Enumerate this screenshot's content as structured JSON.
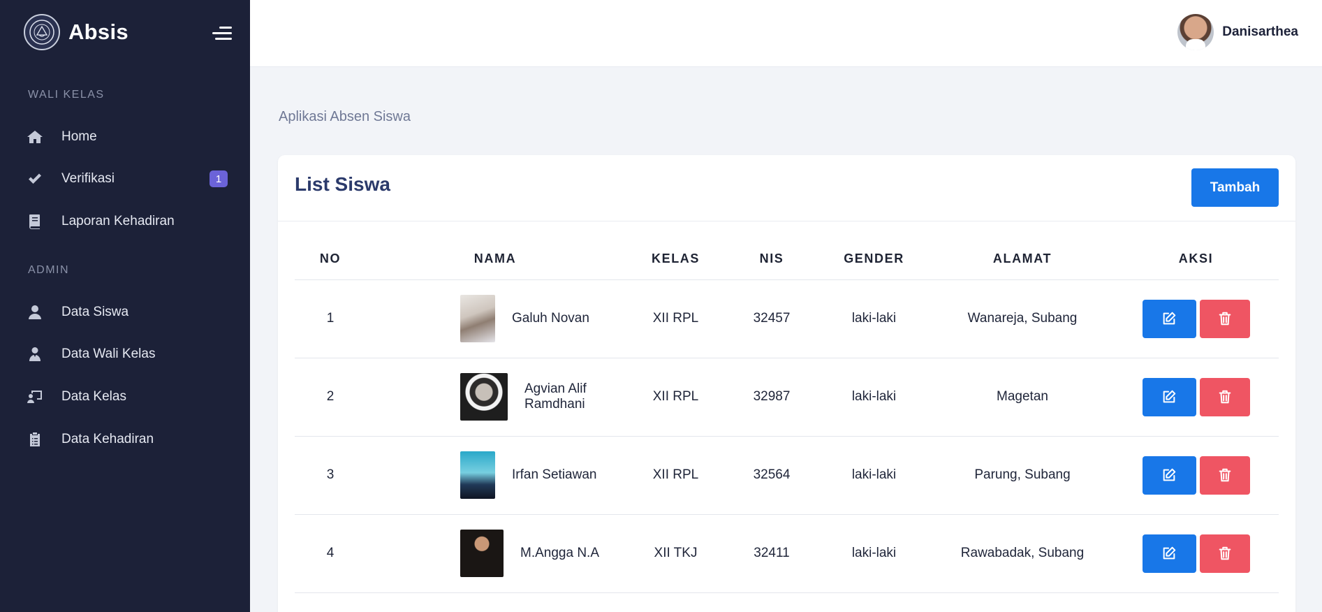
{
  "app": {
    "name": "Absis",
    "logo_icon": "school-emblem-icon",
    "menu_icon": "hamburger-icon"
  },
  "sidebar": {
    "sections": [
      {
        "title": "WALI KELAS",
        "items": [
          {
            "label": "Home",
            "icon": "home-icon"
          },
          {
            "label": "Verifikasi",
            "icon": "check-icon",
            "badge": "1"
          },
          {
            "label": "Laporan Kehadiran",
            "icon": "book-icon"
          }
        ]
      },
      {
        "title": "ADMIN",
        "items": [
          {
            "label": "Data Siswa",
            "icon": "user-icon"
          },
          {
            "label": "Data Wali Kelas",
            "icon": "user-tie-icon"
          },
          {
            "label": "Data Kelas",
            "icon": "chalkboard-teacher-icon"
          },
          {
            "label": "Data Kehadiran",
            "icon": "clipboard-list-icon"
          }
        ]
      }
    ]
  },
  "topbar": {
    "user_name": "Danisarthea"
  },
  "page": {
    "subtitle": "Aplikasi Absen Siswa"
  },
  "card": {
    "title": "List Siswa",
    "add_button": "Tambah",
    "columns": [
      "NO",
      "NAMA",
      "KELAS",
      "NIS",
      "GENDER",
      "ALAMAT",
      "AKSI"
    ],
    "rows": [
      {
        "no": "1",
        "nama": "Galuh Novan",
        "kelas": "XII RPL",
        "nis": "32457",
        "gender": "laki-laki",
        "alamat": "Wanareja, Subang"
      },
      {
        "no": "2",
        "nama": "Agvian Alif Ramdhani",
        "kelas": "XII RPL",
        "nis": "32987",
        "gender": "laki-laki",
        "alamat": "Magetan"
      },
      {
        "no": "3",
        "nama": "Irfan Setiawan",
        "kelas": "XII RPL",
        "nis": "32564",
        "gender": "laki-laki",
        "alamat": "Parung, Subang"
      },
      {
        "no": "4",
        "nama": "M.Angga N.A",
        "kelas": "XII TKJ",
        "nis": "32411",
        "gender": "laki-laki",
        "alamat": "Rawabadak, Subang"
      }
    ],
    "edit_icon": "edit-icon",
    "delete_icon": "trash-icon"
  },
  "colors": {
    "sidebar_bg": "#1c2138",
    "primary": "#1877e8",
    "danger": "#ef5563",
    "badge": "#6b63d8",
    "page_bg": "#f2f4f8"
  }
}
